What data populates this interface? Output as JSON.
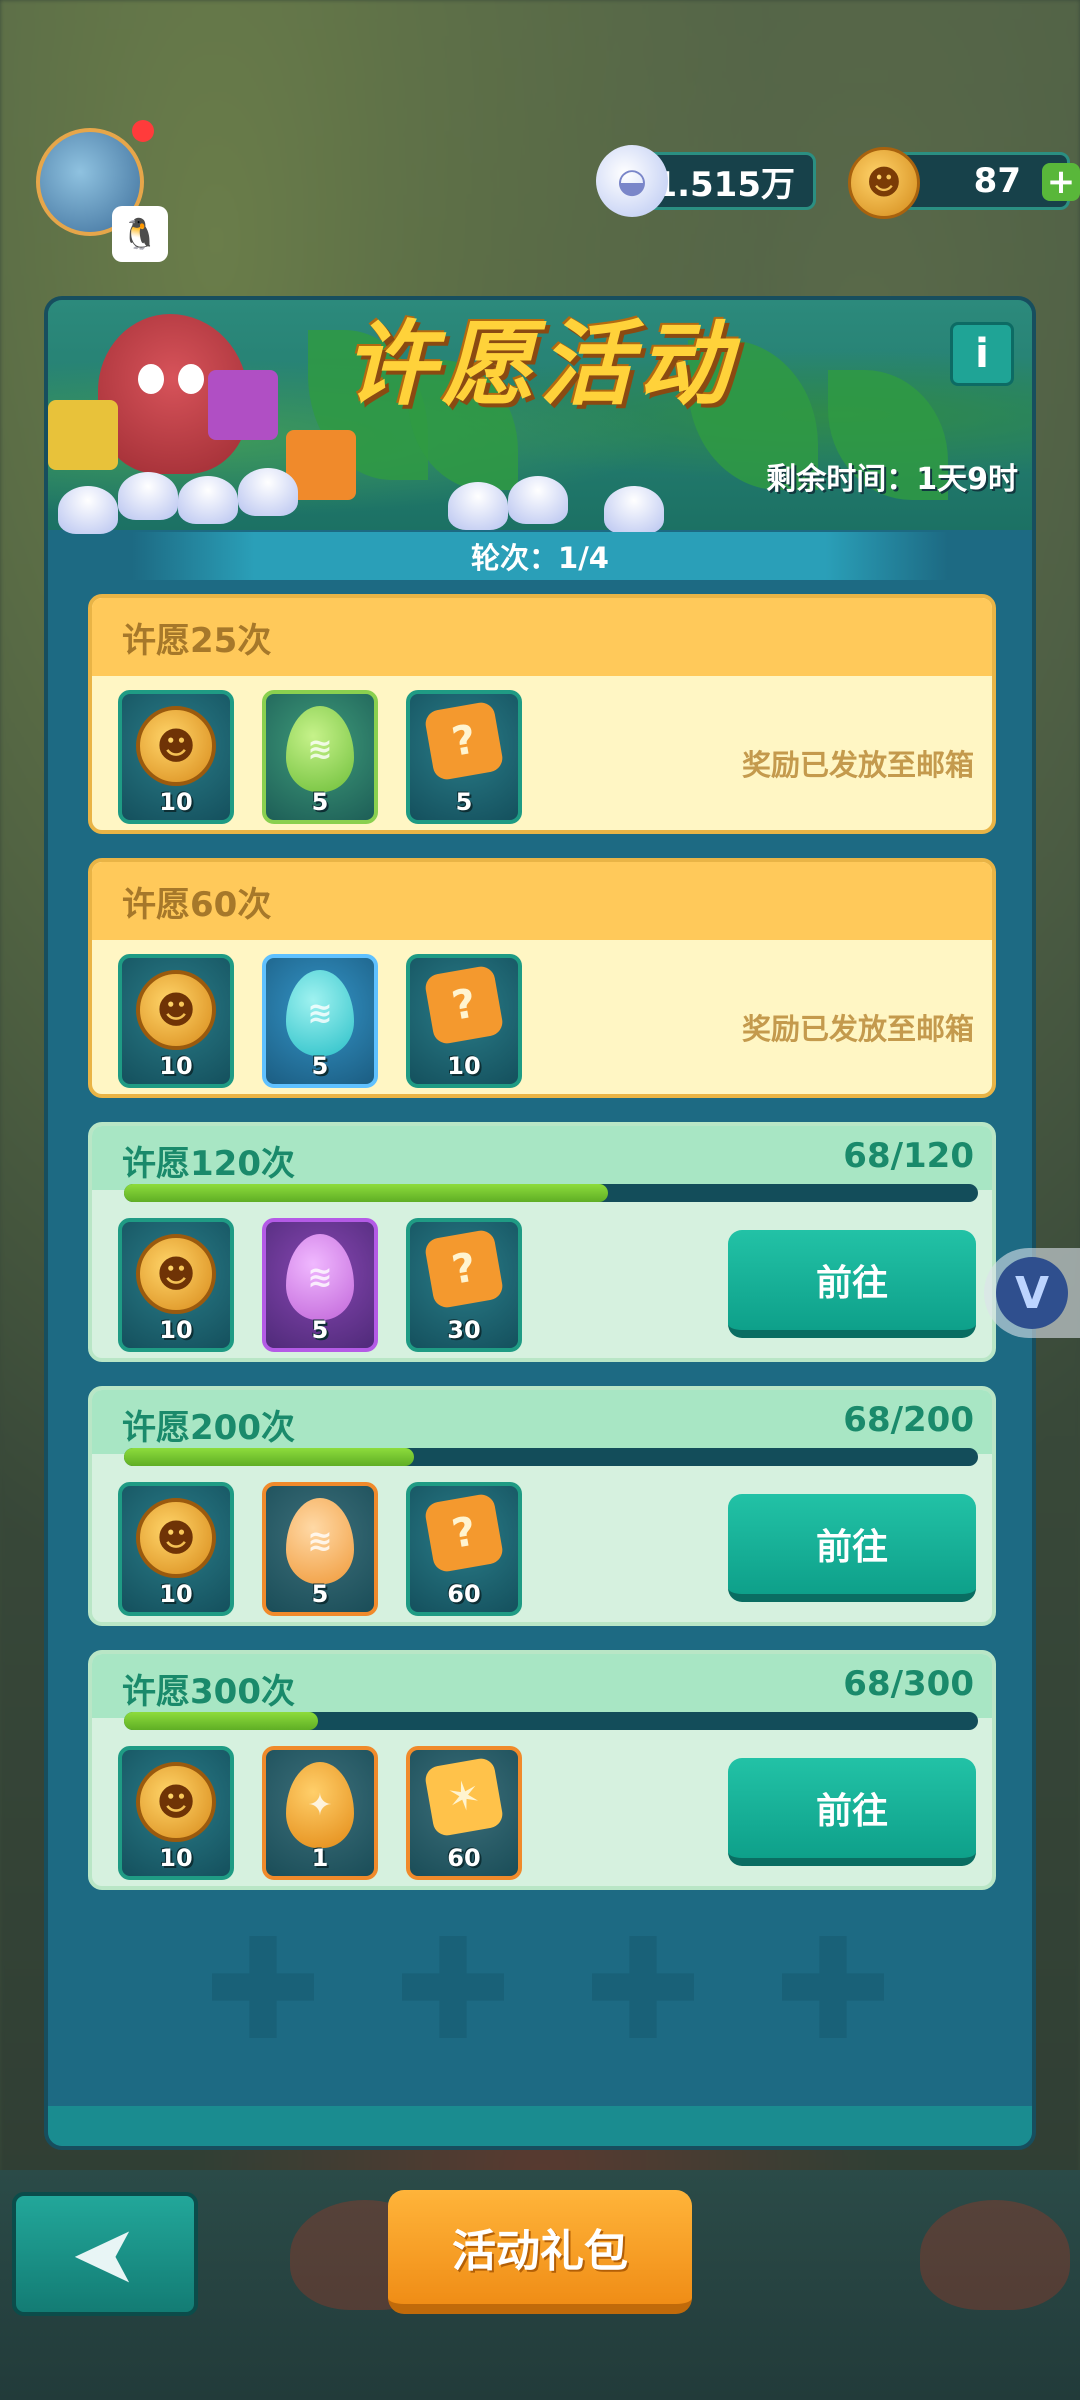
{
  "header": {
    "shells": "1.515万",
    "coins": "87"
  },
  "event": {
    "title": "许愿活动",
    "time_left": "剩余时间：1天9时",
    "round": "轮次：1/4"
  },
  "tiers": [
    {
      "label": "许愿25次",
      "status": "奖励已发放至邮箱",
      "rewards": [
        {
          "type": "coin-icon",
          "qty": "10"
        },
        {
          "type": "green-egg-icon",
          "qty": "5"
        },
        {
          "type": "puzzle-piece-icon",
          "qty": "5"
        }
      ]
    },
    {
      "label": "许愿60次",
      "status": "奖励已发放至邮箱",
      "rewards": [
        {
          "type": "coin-icon",
          "qty": "10"
        },
        {
          "type": "blue-egg-icon",
          "qty": "5"
        },
        {
          "type": "puzzle-piece-icon",
          "qty": "10"
        }
      ]
    },
    {
      "label": "许愿120次",
      "count": "68/120",
      "progress": 0.567,
      "button": "前往",
      "rewards": [
        {
          "type": "coin-icon",
          "qty": "10"
        },
        {
          "type": "purple-egg-icon",
          "qty": "5"
        },
        {
          "type": "puzzle-piece-icon",
          "qty": "30"
        }
      ]
    },
    {
      "label": "许愿200次",
      "count": "68/200",
      "progress": 0.34,
      "button": "前往",
      "rewards": [
        {
          "type": "coin-icon",
          "qty": "10"
        },
        {
          "type": "orange-egg-icon",
          "qty": "5"
        },
        {
          "type": "puzzle-piece-icon",
          "qty": "60"
        }
      ]
    },
    {
      "label": "许愿300次",
      "count": "68/300",
      "progress": 0.227,
      "button": "前往",
      "rewards": [
        {
          "type": "coin-icon",
          "qty": "10"
        },
        {
          "type": "golden-egg-icon",
          "qty": "1"
        },
        {
          "type": "golden-puzzle-icon",
          "qty": "60"
        }
      ]
    }
  ],
  "footer": {
    "gift_button": "活动礼包"
  },
  "colors": {
    "accent": "#0ea08a",
    "panel": "#1d6a83",
    "progress": "#8ddc3c",
    "title": "#ffd23a"
  }
}
